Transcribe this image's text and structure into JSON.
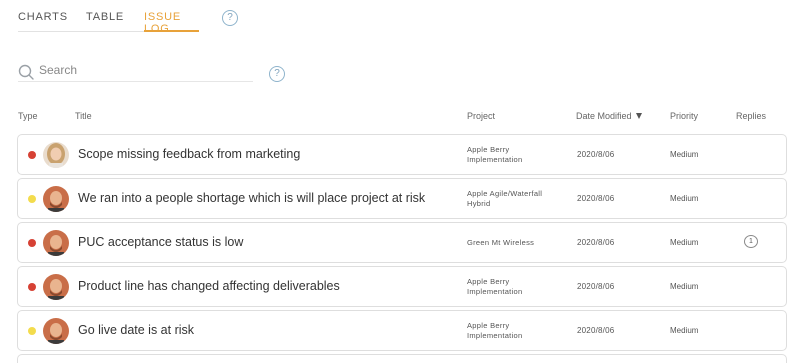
{
  "tabs": [
    {
      "label": "CHARTS",
      "active": false
    },
    {
      "label": "TABLE",
      "active": false
    },
    {
      "label": "ISSUE LOG",
      "active": true
    }
  ],
  "help_label": "?",
  "search": {
    "placeholder": "Search",
    "value": ""
  },
  "columns": {
    "type": "Type",
    "title": "Title",
    "project": "Project",
    "date_modified": "Date Modified",
    "priority": "Priority",
    "replies": "Replies"
  },
  "rows": [
    {
      "status_color": "red",
      "avatar": "female",
      "title": "Scope missing feedback from marketing",
      "project": "Apple Berry Implementation",
      "date": "2020/8/06",
      "priority": "Medium",
      "replies": ""
    },
    {
      "status_color": "yellow",
      "avatar": "male",
      "title": "We ran into a people shortage which is will place project at risk",
      "project": "Apple Agile/Waterfall Hybrid",
      "date": "2020/8/06",
      "priority": "Medium",
      "replies": ""
    },
    {
      "status_color": "red",
      "avatar": "male",
      "title": "PUC acceptance status is low",
      "project": "Green Mt Wireless",
      "date": "2020/8/06",
      "priority": "Medium",
      "replies": "1"
    },
    {
      "status_color": "red",
      "avatar": "male",
      "title": "Product line has changed affecting deliverables",
      "project": "Apple Berry Implementation",
      "date": "2020/8/06",
      "priority": "Medium",
      "replies": ""
    },
    {
      "status_color": "yellow",
      "avatar": "male",
      "title": "Go live date is at risk",
      "project": "Apple Berry Implementation",
      "date": "2020/8/06",
      "priority": "Medium",
      "replies": ""
    }
  ],
  "colors": {
    "accent": "#e8a23a",
    "status_red": "#d64134",
    "status_yellow": "#f3dc4d",
    "help_blue": "#7fa3bd"
  },
  "icons": {
    "help": "question-circle-icon",
    "search": "search-icon",
    "sort": "sort-desc-icon",
    "reply": "comment-bubble-icon"
  }
}
